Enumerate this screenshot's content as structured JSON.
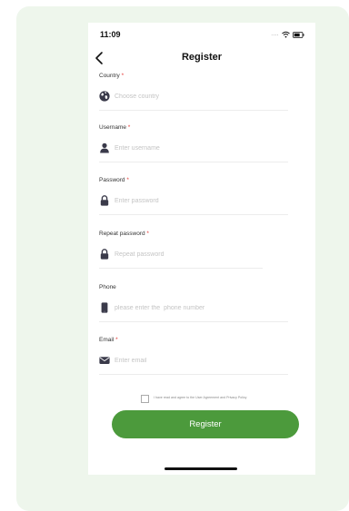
{
  "status_bar": {
    "time": "11:09",
    "signal_dots": "....",
    "icons": [
      "wifi-icon",
      "battery-icon"
    ]
  },
  "header": {
    "title": "Register",
    "back_icon": "chevron-left-icon"
  },
  "form": {
    "fields": [
      {
        "label": "Country",
        "required": "*",
        "placeholder": "Choose country",
        "value": "",
        "icon": "globe-icon"
      },
      {
        "label": "Username",
        "required": "*",
        "placeholder": "Enter username",
        "value": "",
        "icon": "person-icon"
      },
      {
        "label": "Password",
        "required": "*",
        "placeholder": "Enter password",
        "value": "",
        "icon": "lock-icon"
      },
      {
        "label": "Repeat password",
        "required": "*",
        "placeholder": "Repeat password",
        "value": "",
        "icon": "lock-icon"
      },
      {
        "label": "Phone",
        "required": "",
        "placeholder": "please enter the  phone number",
        "value": "",
        "icon": "phone-icon"
      },
      {
        "label": "Email",
        "required": "*",
        "placeholder": "Enter email",
        "value": "",
        "icon": "envelope-icon"
      }
    ],
    "agreement": {
      "text": "I have read and agree to the User Agreement and Privacy Policy",
      "checked": false
    },
    "submit_label": "Register"
  },
  "colors": {
    "accent": "#4c9a3c",
    "required": "#e53935",
    "background_card": "#eef6ec",
    "icon": "#3a3a4a"
  }
}
